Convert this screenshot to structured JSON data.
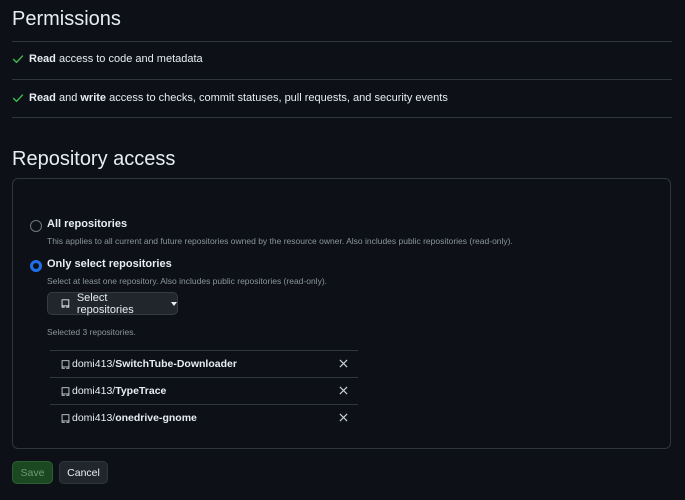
{
  "permissions": {
    "title": "Permissions",
    "items": [
      {
        "bold1": "Read",
        "text1": " access to code and metadata",
        "bold2": "",
        "text2": ""
      },
      {
        "bold1": "Read",
        "text1": " and ",
        "bold2": "write",
        "text2": " access to checks, commit statuses, pull requests, and security events"
      }
    ]
  },
  "repo_access": {
    "title": "Repository access",
    "options": [
      {
        "label": "All repositories",
        "description": "This applies to all current and future repositories owned by the resource owner. Also includes public repositories (read-only).",
        "selected": false
      },
      {
        "label": "Only select repositories",
        "description": "Select at least one repository. Also includes public repositories (read-only).",
        "selected": true
      }
    ],
    "select_button": "Select repositories",
    "selected_count": "Selected 3 repositories.",
    "repos": [
      {
        "owner": "domi413/",
        "name": "SwitchTube-Downloader"
      },
      {
        "owner": "domi413/",
        "name": "TypeTrace"
      },
      {
        "owner": "domi413/",
        "name": "onedrive-gnome"
      }
    ]
  },
  "actions": {
    "save": "Save",
    "cancel": "Cancel"
  },
  "colors": {
    "accent": "#1f6feb",
    "check": "#3fb950",
    "background": "#0d1117"
  },
  "icons": {
    "check": "check-icon",
    "repo": "repo-icon",
    "remove": "x-icon",
    "caret": "caret-down-icon"
  }
}
